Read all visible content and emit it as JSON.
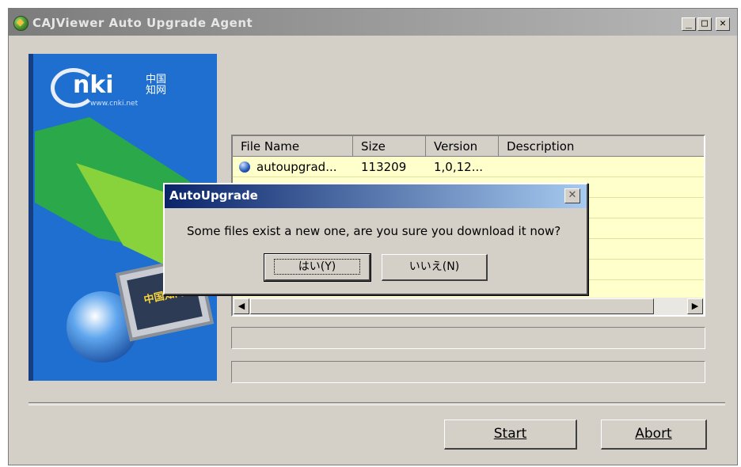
{
  "window": {
    "title": "CAJViewer Auto Upgrade Agent",
    "minimize": "_",
    "maximize": "□",
    "close": "✕"
  },
  "banner": {
    "logo_text": "nki",
    "logo_cn": "中国\n知网",
    "logo_url": "www.cnki.net",
    "screen_text": "中国知网"
  },
  "file_list": {
    "columns": [
      "File Name",
      "Size",
      "Version",
      "Description"
    ],
    "rows": [
      {
        "name": "autoupgrad...",
        "size": "113209",
        "version": "1,0,12...",
        "description": ""
      }
    ],
    "scroll_left": "◀",
    "scroll_right": "▶"
  },
  "progress": [
    {
      "value": 0
    },
    {
      "value": 0
    }
  ],
  "buttons": {
    "start": "Start",
    "abort": "Abort"
  },
  "dialog": {
    "title": "AutoUpgrade",
    "close": "✕",
    "message": "Some files exist a new one, are you sure you download it now?",
    "yes": "はい(Y)",
    "no": "いいえ(N)"
  }
}
